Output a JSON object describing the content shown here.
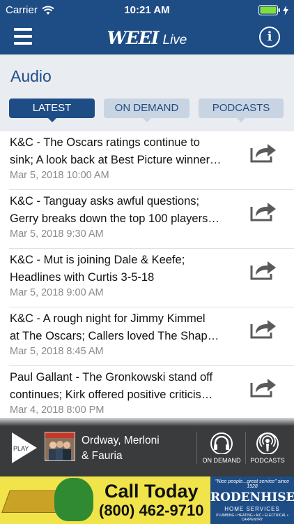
{
  "status_bar": {
    "carrier": "Carrier",
    "time": "10:21 AM"
  },
  "navbar": {
    "logo_text": "WEEI",
    "logo_suffix": "Live",
    "info_label": "i"
  },
  "page_title": "Audio",
  "tabs": [
    {
      "label": "LATEST",
      "active": true
    },
    {
      "label": "ON DEMAND",
      "active": false
    },
    {
      "label": "PODCASTS",
      "active": false
    }
  ],
  "episodes": [
    {
      "line1": "K&C - The Oscars ratings continue to",
      "line2": "sink; A look back at Best Picture winner…",
      "date": "Mar 5, 2018 10:00 AM"
    },
    {
      "line1": "K&C - Tanguay asks awful questions;",
      "line2": "Gerry breaks down the top 100 players…",
      "date": "Mar 5, 2018 9:30 AM"
    },
    {
      "line1": "K&C - Mut is joining Dale & Keefe;",
      "line2": "Headlines with Curtis 3-5-18",
      "date": "Mar 5, 2018 9:00 AM"
    },
    {
      "line1": "K&C - A rough night for Jimmy Kimmel",
      "line2": "at The Oscars; Callers loved The Shap…",
      "date": "Mar 5, 2018 8:45 AM"
    },
    {
      "line1": "Paul Gallant - The Gronkowski stand off",
      "line2": "continues; Kirk offered positive criticis…",
      "date": "Mar 4, 2018 8:00 PM"
    }
  ],
  "player": {
    "play_label": "PLAY",
    "show_line1": "Ordway, Merloni",
    "show_line2": "& Fauria",
    "on_demand_label": "ON DEMAND",
    "podcasts_label": "PODCASTS"
  },
  "ad": {
    "headline": "Call Today",
    "phone": "(800) 462-9710",
    "tagline": "\"Nice people...great service\" since 1928",
    "brand_name": "RODENHISER",
    "brand_sub": "HOME SERVICES",
    "brand_fine": "PLUMBING • HEATING • A/C • ELECTRICAL • CARPENTRY"
  },
  "colors": {
    "brand_blue": "#1e4d86",
    "tab_inactive": "#c9d4e3",
    "player_bg": "#3a3b3d",
    "ad_yellow": "#f0e44a"
  }
}
